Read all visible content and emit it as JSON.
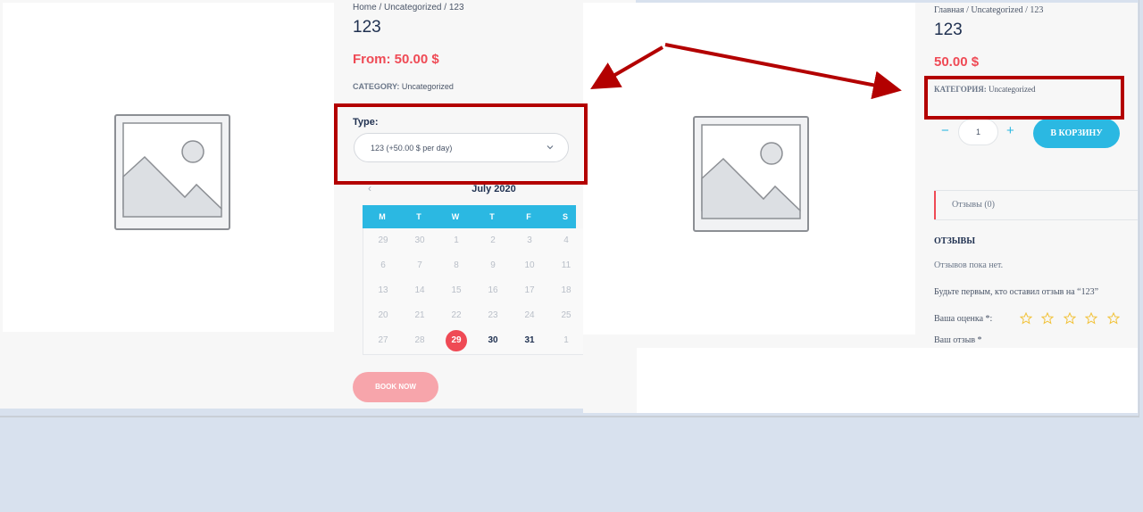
{
  "left_page": {
    "breadcrumb": "Home / Uncategorized / 123",
    "title": "123",
    "price": "From: 50.00 $",
    "category_label": "CATEGORY:",
    "category_value": "Uncategorized",
    "type_label": "Type:",
    "type_selected": "123 (+50.00 $ per day)",
    "calendar": {
      "month": "July 2020",
      "prev_glyph": "‹",
      "weekdays": [
        "M",
        "T",
        "W",
        "T",
        "F",
        "S"
      ],
      "weeks": [
        [
          "29",
          "30",
          "1",
          "2",
          "3",
          "4"
        ],
        [
          "6",
          "7",
          "8",
          "9",
          "10",
          "11"
        ],
        [
          "13",
          "14",
          "15",
          "16",
          "17",
          "18"
        ],
        [
          "20",
          "21",
          "22",
          "23",
          "24",
          "25"
        ],
        [
          "27",
          "28",
          "29",
          "30",
          "31",
          "1"
        ]
      ]
    },
    "book_button": "BOOK NOW"
  },
  "right_page": {
    "breadcrumb": "Главная / Uncategorized / 123",
    "title": "123",
    "price": "50.00 $",
    "category_label": "КАТЕГОРИЯ:",
    "category_value": "Uncategorized",
    "quantity": "1",
    "minus_glyph": "−",
    "plus_glyph": "+",
    "cart_button": "В КОРЗИНУ",
    "reviews_tab": "Отзывы (0)",
    "reviews_heading": "ОТЗЫВЫ",
    "no_reviews": "Отзывов пока нет.",
    "be_first": "Будьте первым, кто оставил отзыв на “123”",
    "rating_label": "Ваша оценка *:",
    "rating_stars": 5,
    "your_review_label": "Ваш отзыв *"
  },
  "colors": {
    "accent_red": "#ef4a55",
    "accent_blue": "#2bb8e2",
    "annotation_red": "#b30000"
  },
  "icons": [
    "image-placeholder-icon",
    "chevron-down-icon",
    "chevron-left-icon",
    "star-icon",
    "arrow-annotation"
  ]
}
